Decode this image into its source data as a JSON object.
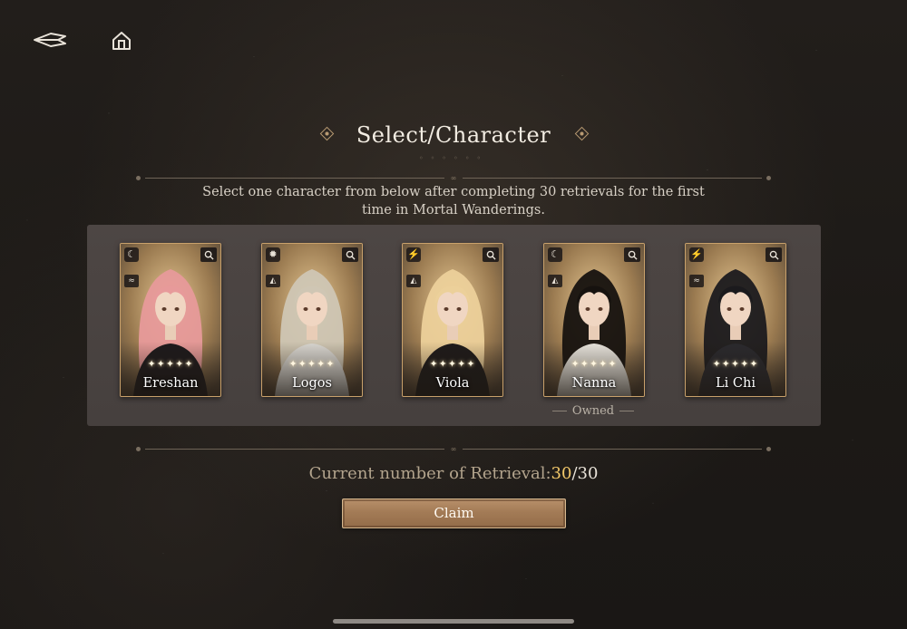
{
  "nav": {
    "back_icon": "back-arrow-icon",
    "home_icon": "home-icon"
  },
  "header": {
    "title": "Select/Character"
  },
  "description": "Select one character from below after completing 30 retrievals for the first time in Mortal Wanderings.",
  "characters": [
    {
      "name": "Ereshan",
      "stars": "✦✦✦✦✦",
      "element_icon": "moon-icon",
      "element_color": "#b05ee0",
      "role_icon": "wave-icon",
      "hair_color": "#e79a9a",
      "outfit_color": "#1e1a1c",
      "owned": false
    },
    {
      "name": "Logos",
      "stars": "✦✦✦✦✦",
      "element_icon": "sun-icon",
      "element_color": "#e0a040",
      "role_icon": "triangle-icon",
      "hair_color": "#cfc6b4",
      "outfit_color": "#d9d6d0",
      "owned": false
    },
    {
      "name": "Viola",
      "stars": "✦✦✦✦✦",
      "element_icon": "bolt-icon",
      "element_color": "#3fd6d0",
      "role_icon": "triangle-icon",
      "hair_color": "#ecd09a",
      "outfit_color": "#1f1b1a",
      "owned": false
    },
    {
      "name": "Nanna",
      "stars": "✦✦✦✦✦",
      "element_icon": "moon-icon",
      "element_color": "#b05ee0",
      "role_icon": "triangle-icon",
      "hair_color": "#16120f",
      "outfit_color": "#e8e4dc",
      "owned": true
    },
    {
      "name": "Li Chi",
      "stars": "✦✦✦✦✦",
      "element_icon": "bolt-icon",
      "element_color": "#3fd6d0",
      "role_icon": "wave-icon",
      "hair_color": "#1b1a1d",
      "outfit_color": "#2b2a2e",
      "owned": false
    }
  ],
  "owned_label": "Owned",
  "retrieval": {
    "label": "Current number of Retrieval:",
    "current": "30",
    "total": "/30"
  },
  "claim_label": "Claim",
  "colors": {
    "accent_gold": "#f2c86a",
    "card_border": "#c9a16b",
    "button_brown": "#a37b56"
  }
}
